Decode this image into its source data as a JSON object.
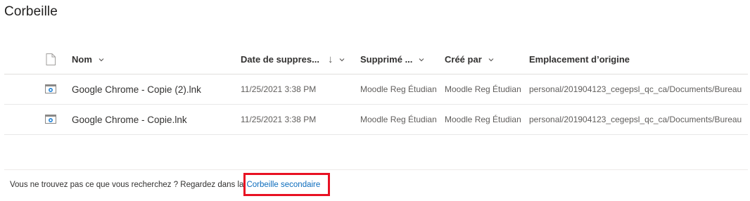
{
  "page": {
    "title": "Corbeille"
  },
  "columns": {
    "name": "Nom",
    "deleted_date": "Date de suppres...",
    "deleted_by": "Supprimé ...",
    "created_by": "Créé par",
    "original_location": "Emplacement d’origine"
  },
  "rows": [
    {
      "icon": "shortcut-file-icon",
      "name": "Google Chrome - Copie (2).lnk",
      "deleted_date": "11/25/2021 3:38 PM",
      "deleted_by": "Moodle Reg Étudian",
      "created_by": "Moodle Reg Étudian",
      "original_location": "personal/201904123_cegepsl_qc_ca/Documents/Bureau"
    },
    {
      "icon": "shortcut-file-icon",
      "name": "Google Chrome - Copie.lnk",
      "deleted_date": "11/25/2021 3:38 PM",
      "deleted_by": "Moodle Reg Étudian",
      "created_by": "Moodle Reg Étudian",
      "original_location": "personal/201904123_cegepsl_qc_ca/Documents/Bureau"
    }
  ],
  "footer": {
    "text": "Vous ne trouvez pas ce que vous recherchez ? Regardez dans la",
    "link": "Corbeille secondaire"
  },
  "colors": {
    "link": "#0b6cbd",
    "highlight": "#e81123"
  }
}
